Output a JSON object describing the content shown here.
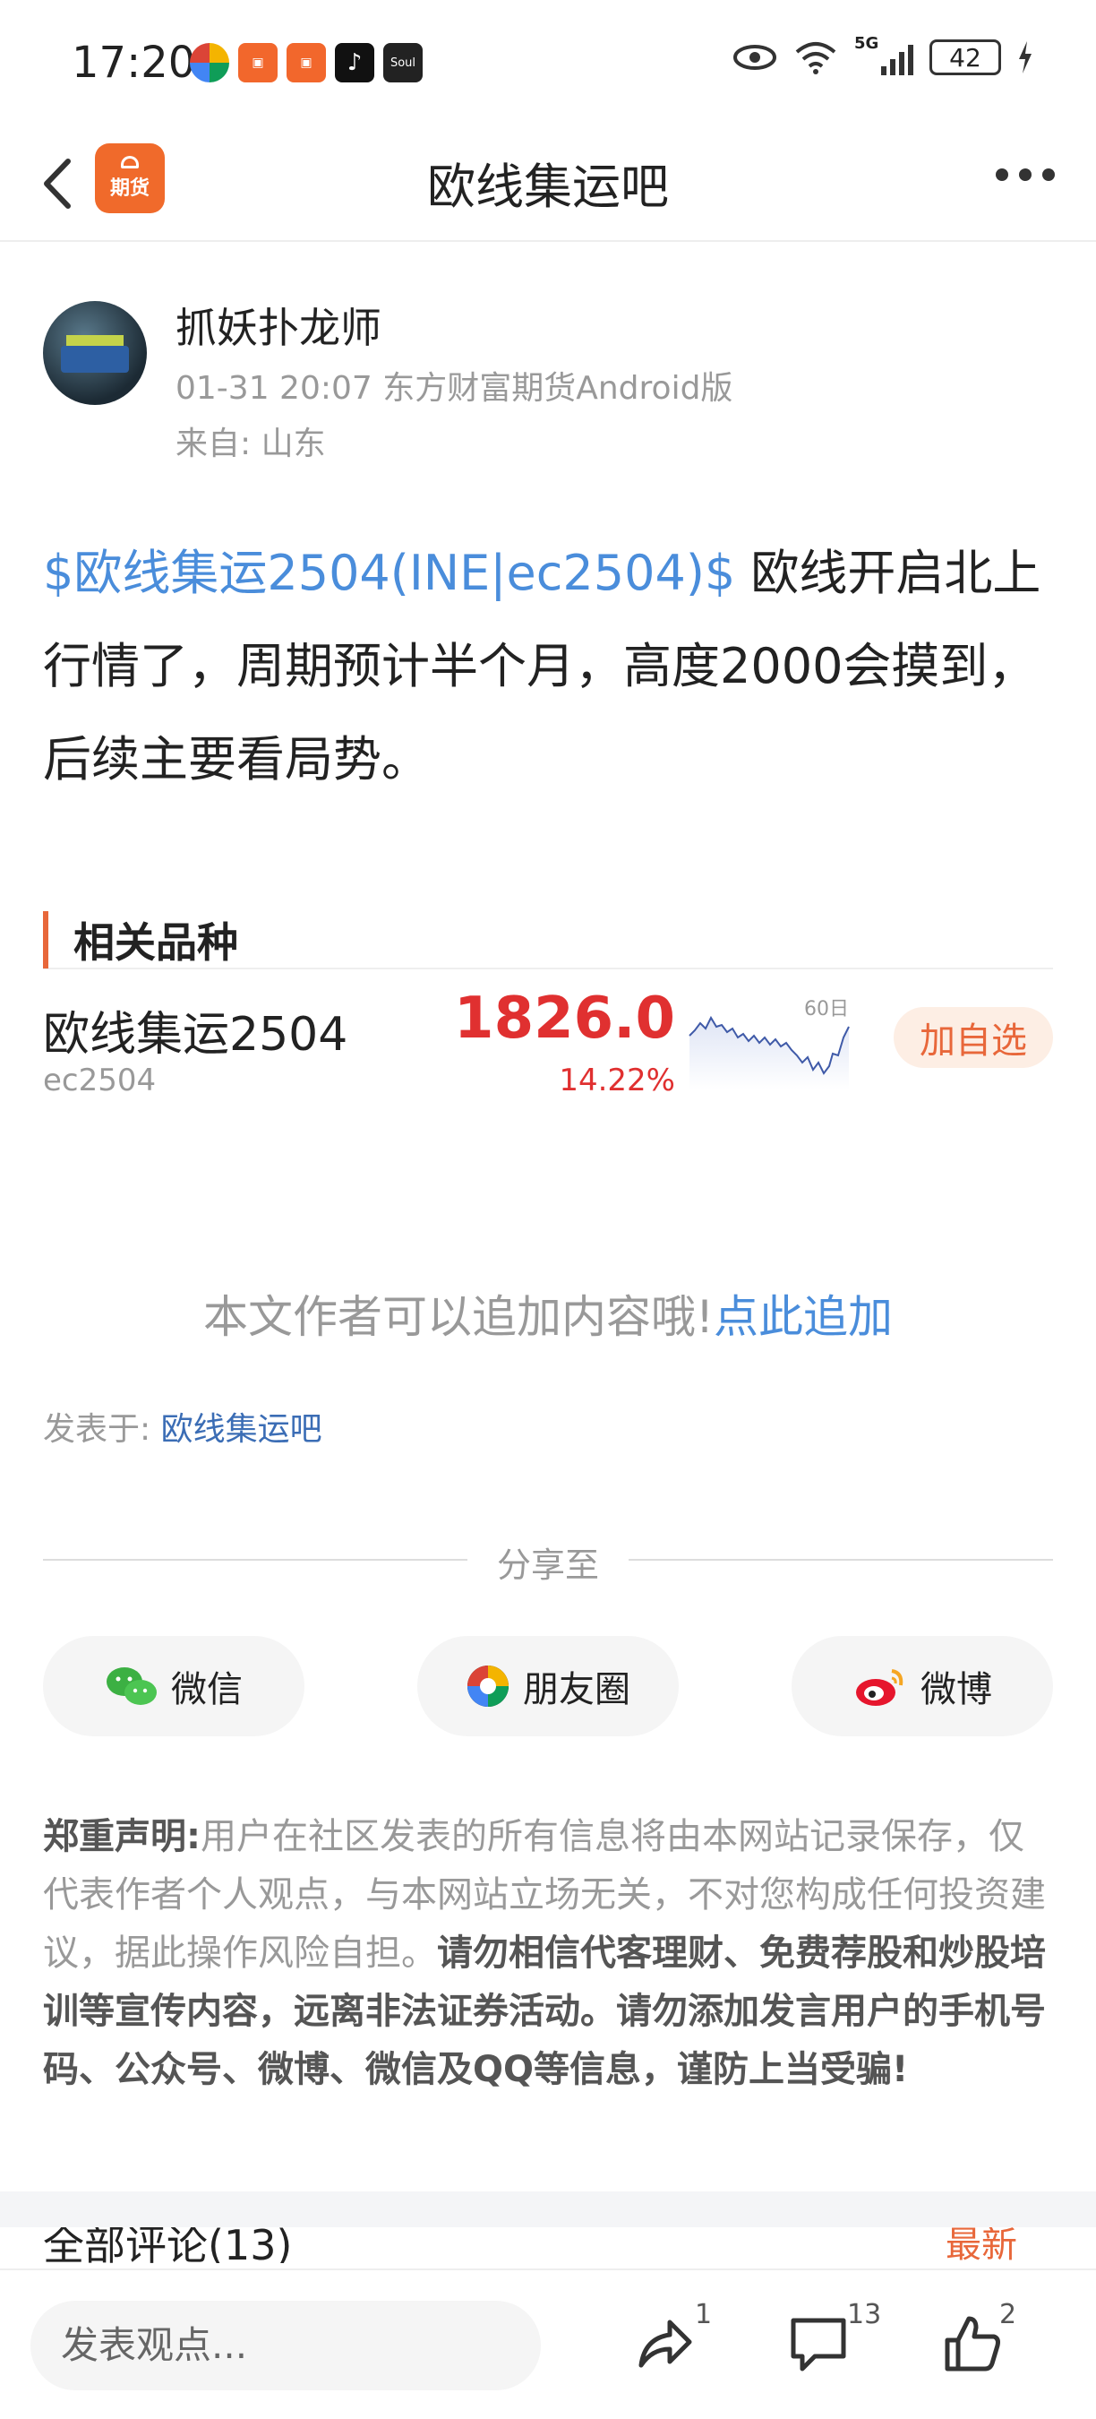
{
  "status_bar": {
    "time": "17:20",
    "battery": "42",
    "network": "5G",
    "app_icons": [
      "photos-icon",
      "kuaishou-icon",
      "kuaishou-icon",
      "tiktok-icon",
      "soul-icon"
    ],
    "soul_label": "Soul"
  },
  "nav": {
    "title": "欧线集运吧",
    "logo_text": "期货"
  },
  "author": {
    "name": "抓妖扑龙师",
    "meta": "01-31 20:07 东方财富期货Android版",
    "from": "来自: 山东"
  },
  "post": {
    "tag": "$欧线集运2504(INE|ec2504)$",
    "text": " 欧线开启北上行情了，周期预计半个月，高度2000会摸到，后续主要看局势。"
  },
  "related": {
    "title": "相关品种",
    "product": {
      "name": "欧线集运2504",
      "code": "ec2504",
      "price": "1826.0",
      "change": "14.22%",
      "chart_label": "60日",
      "add_label": "加自选"
    }
  },
  "append": {
    "text": "本文作者可以追加内容哦!",
    "link": "点此追加"
  },
  "posted_in": {
    "label": "发表于: ",
    "link": "欧线集运吧"
  },
  "share": {
    "label": "分享至",
    "buttons": [
      {
        "label": "微信",
        "icon": "wechat-icon"
      },
      {
        "label": "朋友圈",
        "icon": "moments-icon"
      },
      {
        "label": "微博",
        "icon": "weibo-icon"
      }
    ]
  },
  "disclaimer": {
    "heading": "郑重声明:",
    "normal": "用户在社区发表的所有信息将由本网站记录保存，仅代表作者个人观点，与本网站立场无关，不对您构成任何投资建议，据此操作风险自担。",
    "bold": "请勿相信代客理财、免费荐股和炒股培训等宣传内容，远离非法证券活动。请勿添加发言用户的手机号码、公众号、微博、微信及QQ等信息，谨防上当受骗!"
  },
  "comments": {
    "title": "全部评论(13)",
    "sort": "最新"
  },
  "bottom_bar": {
    "input_placeholder": "发表观点...",
    "share_count": "1",
    "comment_count": "13",
    "like_count": "2"
  },
  "colors": {
    "accent": "#e8673a",
    "link": "#4a8ddb",
    "price_up": "#e03030"
  }
}
